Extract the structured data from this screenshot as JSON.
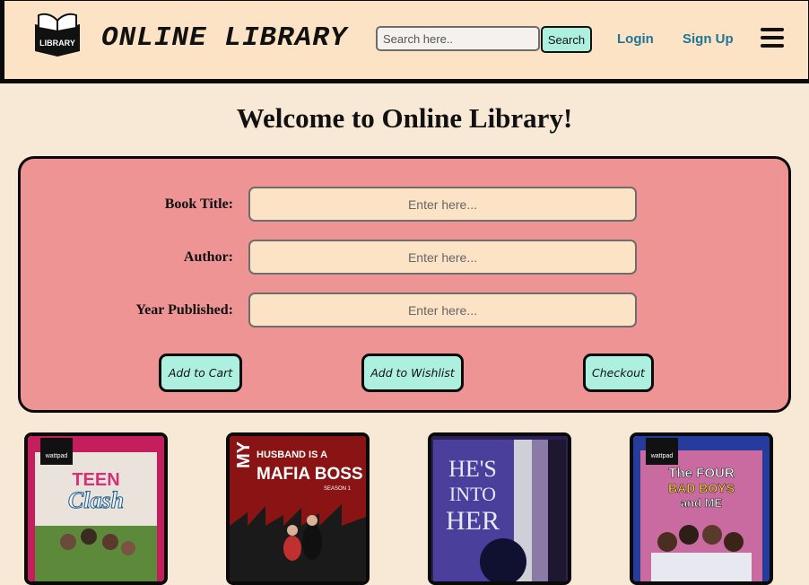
{
  "header": {
    "brand": "ONLINE LIBRARY",
    "logo_text": "LIBRARY",
    "search_placeholder": "Search here..",
    "search_button": "Search",
    "login": "Login",
    "signup": "Sign Up"
  },
  "page_title": "Welcome to Online Library!",
  "form": {
    "fields": [
      {
        "label": "Book Title:",
        "placeholder": "Enter here..."
      },
      {
        "label": "Author:",
        "placeholder": "Enter here..."
      },
      {
        "label": "Year Published:",
        "placeholder": "Enter here..."
      }
    ],
    "buttons": {
      "add_to_cart": "Add to Cart",
      "add_to_wishlist": "Add to Wishlist",
      "checkout": "Checkout"
    }
  },
  "books": [
    {
      "line1": "TEEN",
      "line2": "Clash",
      "badge": "wattpad",
      "color": "#c41f5c"
    },
    {
      "line1": "MY",
      "line2": "HUSBAND IS A",
      "line3": "MAFIA BOSS",
      "line4": "SEASON 1",
      "color": "#8a1414"
    },
    {
      "line1": "HE'S",
      "line2": "INTO",
      "line3": "HER",
      "color": "#2b1f56"
    },
    {
      "line1": "The FOUR",
      "line2": "BAD BOYS",
      "line3": "and ME",
      "badge": "wattpad",
      "color": "#253c9c"
    }
  ],
  "colors": {
    "background": "#f8e8d6",
    "header_bg": "#fde3c5",
    "panel_bg": "#ee9494",
    "button_bg": "#aef0e0",
    "link": "#1e7597"
  }
}
